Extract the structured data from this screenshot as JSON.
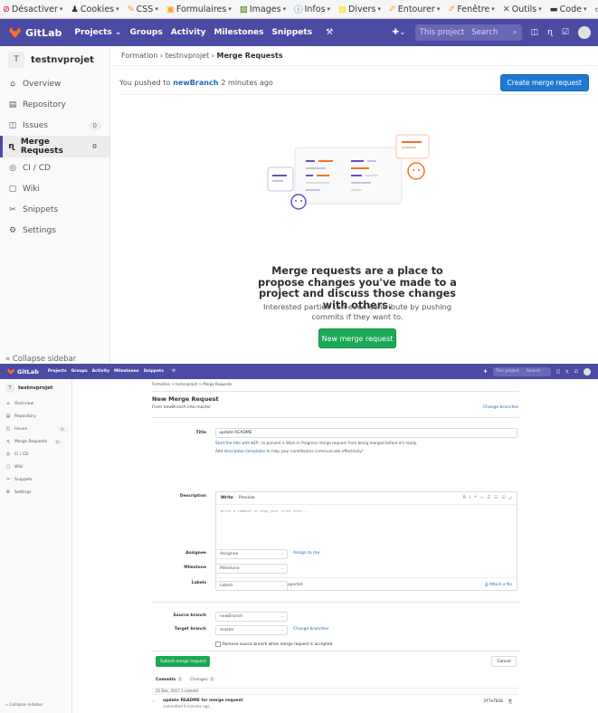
{
  "browser_toolbar": {
    "items": [
      {
        "label": "Désactiver",
        "icon": "no-entry-icon",
        "color": "#d0021b"
      },
      {
        "label": "Cookies",
        "icon": "person-icon",
        "color": "#333333"
      },
      {
        "label": "CSS",
        "icon": "pencil-icon",
        "color": "#f5a623"
      },
      {
        "label": "Formulaires",
        "icon": "form-icon",
        "color": "#f5a623"
      },
      {
        "label": "Images",
        "icon": "image-icon",
        "color": "#417505"
      },
      {
        "label": "Infos",
        "icon": "info-icon",
        "color": "#1b69b6"
      },
      {
        "label": "Divers",
        "icon": "misc-icon",
        "color": "#f8e71c"
      },
      {
        "label": "Entourer",
        "icon": "pen-icon",
        "color": "#f5a623"
      },
      {
        "label": "Fenêtre",
        "icon": "pen-icon",
        "color": "#f5a623"
      },
      {
        "label": "Outils",
        "icon": "tools-icon",
        "color": "#555555"
      },
      {
        "label": "Code",
        "icon": "code-icon",
        "color": "#333333"
      },
      {
        "label": "Options",
        "icon": "options-icon",
        "color": "#333333"
      }
    ]
  },
  "navbar": {
    "brand": "GitLab",
    "links": [
      "Projects",
      "Groups",
      "Activity",
      "Milestones",
      "Snippets"
    ],
    "search_scope": "This project",
    "search_placeholder": "Search"
  },
  "sidebar": {
    "project_initial": "T",
    "project_name": "testnvprojet",
    "items": [
      {
        "label": "Overview",
        "icon": "home-icon"
      },
      {
        "label": "Repository",
        "icon": "book-icon"
      },
      {
        "label": "Issues",
        "icon": "issues-icon",
        "count": "0"
      },
      {
        "label": "Merge Requests",
        "icon": "merge-request-icon",
        "count": "0"
      },
      {
        "label": "CI / CD",
        "icon": "pipeline-icon"
      },
      {
        "label": "Wiki",
        "icon": "wiki-icon"
      },
      {
        "label": "Snippets",
        "icon": "scissors-icon"
      },
      {
        "label": "Settings",
        "icon": "gear-icon"
      }
    ],
    "collapse_label": "Collapse sidebar"
  },
  "main_top": {
    "breadcrumb_group": "Formation",
    "breadcrumb_project": "testnvprojet",
    "breadcrumb_current": "Merge Requests",
    "push_prefix": "You pushed to",
    "push_branch": "newBranch",
    "push_suffix": "2 minutes ago",
    "create_button": "Create merge request",
    "empty_title": "Merge requests are a place to propose changes you've made to a project and discuss those changes with others.",
    "empty_text": "Interested parties can even contribute by pushing commits if they want to.",
    "new_button": "New merge request"
  },
  "new_mr": {
    "breadcrumb": "Formation > testnvprojet > Merge Requests",
    "title": "New Merge Request",
    "from_text": "From newBranch into master",
    "change_branches": "Change branches",
    "title_label": "Title",
    "title_value": "update README",
    "wip_hint_pre": "Start the title with",
    "wip_tag": "WIP:",
    "wip_hint_post": "to prevent a Work In Progress merge request from being merged before it's ready.",
    "templates_hint_pre": "Add",
    "templates_link": "description templates",
    "templates_hint_post": "to help your contributors communicate effectively!",
    "description_label": "Description",
    "tab_write": "Write",
    "tab_preview": "Preview",
    "editor_placeholder": "Write a comment or drag your files here...",
    "markdown_link": "Markdown",
    "markdown_and": "and",
    "quick_actions_link": "quick actions",
    "markdown_suffix": "are supported",
    "attach_file": "Attach a file",
    "assignee_label": "Assignee",
    "assignee_value": "Assignee",
    "assign_to_me": "Assign to me",
    "milestone_label": "Milestone",
    "milestone_value": "Milestone",
    "labels_label": "Labels",
    "labels_value": "Labels",
    "source_label": "Source branch",
    "source_value": "newBranch",
    "target_label": "Target branch",
    "target_value": "master",
    "change_branches2": "Change branches",
    "remove_source": "Remove source branch when merge request is accepted.",
    "submit": "Submit merge request",
    "cancel": "Cancel",
    "commits_tab": "Commits",
    "commits_count": "1",
    "changes_tab": "Changes",
    "changes_count": "1",
    "commit_date": "25 Dec, 2017 1 commit",
    "commit_title": "update README for merge request",
    "commit_by": "committed 9 minutes ago",
    "commit_sha": "3f7e7816"
  }
}
